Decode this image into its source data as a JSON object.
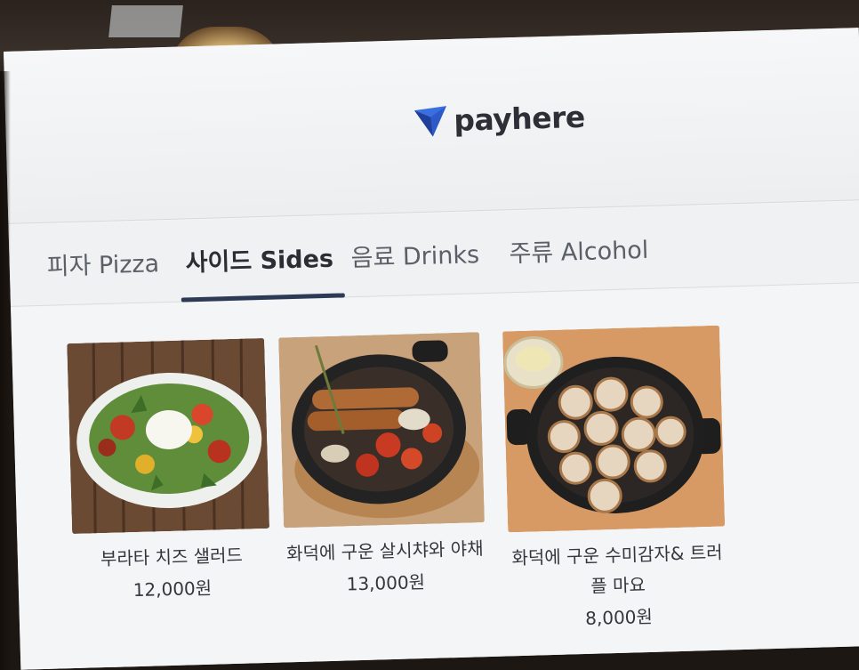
{
  "brand": {
    "name": "payhere",
    "accent": "#3a6fe0",
    "accent_dark": "#1f3f9a"
  },
  "tabs": [
    {
      "label": "피자 Pizza",
      "active": false
    },
    {
      "label": "사이드 Sides",
      "active": true
    },
    {
      "label": "음료 Drinks",
      "active": false
    },
    {
      "label": "주류 Alcohol",
      "active": false
    }
  ],
  "products": [
    {
      "name": "부라타 치즈 샐러드",
      "price": "12,000원",
      "image": "burrata-salad"
    },
    {
      "name": "화덕에 구운 살시챠와 야채",
      "price": "13,000원",
      "image": "sausage-skillet"
    },
    {
      "name": "화덕에 구운 수미감자& 트러플 마요",
      "price": "8,000원",
      "image": "potato-skillet"
    }
  ],
  "colors": {
    "screen": "#f3f4f5",
    "tab_indicator": "#2d3a55",
    "text": "#33363c"
  }
}
